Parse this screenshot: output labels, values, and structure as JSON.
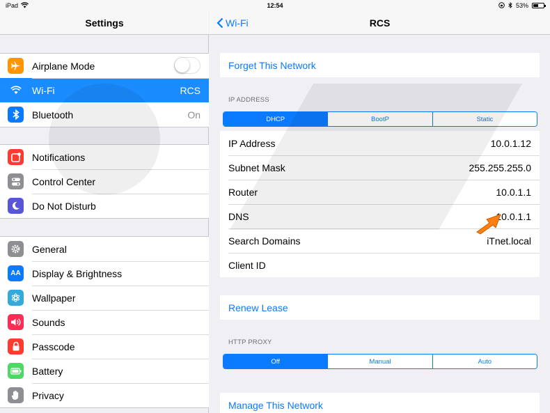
{
  "status_bar": {
    "device": "iPad",
    "time": "12:54",
    "battery": "53%",
    "battery_level": 0.53
  },
  "left": {
    "title": "Settings",
    "group1": [
      {
        "label": "Airplane Mode",
        "icon": "airplane-icon",
        "color": "#ff9500",
        "toggle_on": false
      },
      {
        "label": "Wi-Fi",
        "icon": "wifi-icon",
        "color": "#1a8cff",
        "value": "RCS",
        "selected": true
      },
      {
        "label": "Bluetooth",
        "icon": "bluetooth-icon",
        "color": "#0a7aff",
        "value": "On"
      }
    ],
    "group2": [
      {
        "label": "Notifications",
        "icon": "notifications-icon",
        "color": "#ff3b30"
      },
      {
        "label": "Control Center",
        "icon": "control-center-icon",
        "color": "#8e8e93"
      },
      {
        "label": "Do Not Disturb",
        "icon": "moon-icon",
        "color": "#5856d6"
      }
    ],
    "group3": [
      {
        "label": "General",
        "icon": "gear-icon",
        "color": "#8e8e93"
      },
      {
        "label": "Display & Brightness",
        "icon": "display-icon",
        "color": "#0a7aff",
        "glyph": "AA"
      },
      {
        "label": "Wallpaper",
        "icon": "wallpaper-icon",
        "color": "#34aadc"
      },
      {
        "label": "Sounds",
        "icon": "speaker-icon",
        "color": "#ff2d55"
      },
      {
        "label": "Passcode",
        "icon": "lock-icon",
        "color": "#ff3b30"
      },
      {
        "label": "Battery",
        "icon": "battery-icon",
        "color": "#4cd964"
      },
      {
        "label": "Privacy",
        "icon": "hand-icon",
        "color": "#8e8e93"
      }
    ]
  },
  "right": {
    "back_label": "Wi-Fi",
    "title": "RCS",
    "forget": "Forget This Network",
    "ip_header": "IP ADDRESS",
    "ip_modes": [
      "DHCP",
      "BootP",
      "Static"
    ],
    "ip_mode_selected": "DHCP",
    "details": [
      {
        "label": "IP Address",
        "value": "10.0.1.12"
      },
      {
        "label": "Subnet Mask",
        "value": "255.255.255.0"
      },
      {
        "label": "Router",
        "value": "10.0.1.1"
      },
      {
        "label": "DNS",
        "value": "10.0.1.1"
      },
      {
        "label": "Search Domains",
        "value": "iTnet.local"
      },
      {
        "label": "Client ID",
        "value": ""
      }
    ],
    "renew": "Renew Lease",
    "proxy_header": "HTTP PROXY",
    "proxy_modes": [
      "Off",
      "Manual",
      "Auto"
    ],
    "proxy_mode_selected": "Off",
    "manage": "Manage This Network"
  },
  "colors": {
    "accent": "#0a7aff",
    "selected_row": "#1a8cff",
    "arrow": "#ff7f11"
  }
}
